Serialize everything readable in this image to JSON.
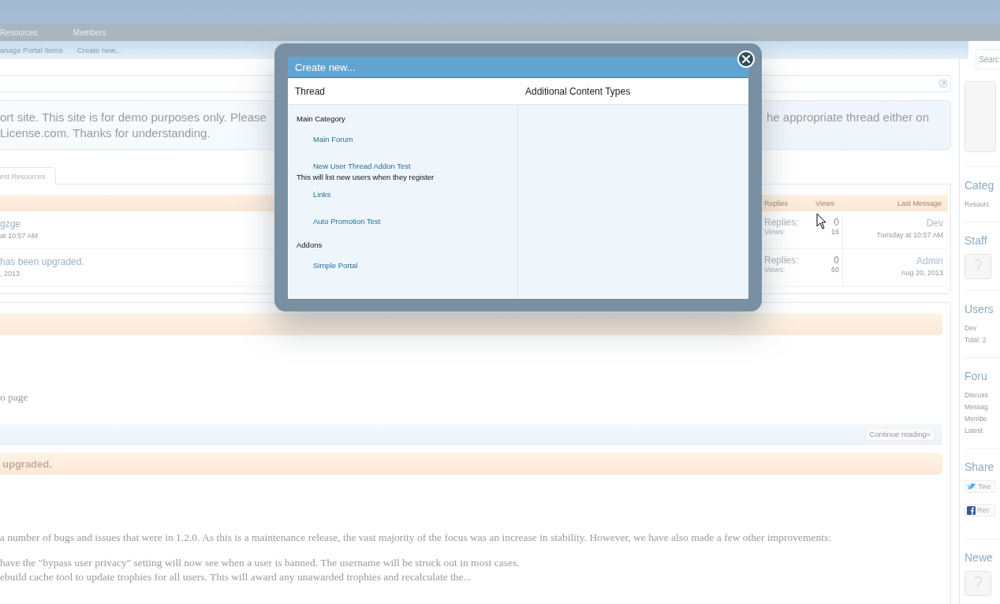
{
  "top_nav": {
    "items": [
      "Resources",
      "Members"
    ]
  },
  "sub_nav": {
    "items": [
      "anage Portal Items",
      "Create new..."
    ]
  },
  "search": {
    "placeholder": "Searc"
  },
  "notice": {
    "left_lines": [
      "ort site. This site is for demo purposes only. Please",
      "License.com. Thanks for understanding."
    ],
    "right_lines": [
      "he appropriate thread either on"
    ]
  },
  "tabs": [
    {
      "label": "est Resources",
      "selected": true
    }
  ],
  "thread_list": {
    "columns": [
      "Replies",
      "Views",
      "Last Message"
    ],
    "rows": [
      {
        "title": "gzge",
        "meta": "at 10:57 AM",
        "replies_label": "Replies:",
        "replies": "0",
        "views_label": "Views:",
        "views": "16",
        "last_user": "Dev",
        "last_date": "Tuesday at 10:57 AM"
      },
      {
        "title": "has been upgraded.",
        "meta": ", 2013",
        "replies_label": "Replies:",
        "replies": "0",
        "views_label": "Views:",
        "views": "60",
        "last_user": "Admin",
        "last_date": "Aug 20, 2013"
      }
    ]
  },
  "posts": [
    {
      "body": [
        "o page"
      ],
      "action": "Continue reading»"
    },
    {
      "title": "upgraded.",
      "body": [
        "a number of bugs and issues that were in 1.2.0. As this is a maintenance release, the vast majority of the focus was an increase in stability. However, we have also made a few other improvements:"
      ],
      "list": [
        "have the \"bypass user privacy\" setting will now see when a user is banned. The username will be struck out in most cases.",
        "ebuild cache tool to update trophies for all users. This will award any unawarded trophies and recalculate the..."
      ]
    }
  ],
  "sidebar": {
    "sections": [
      {
        "kind": "avatar"
      },
      {
        "kind": "list",
        "title": "Categ",
        "lines": [
          "Resourc"
        ]
      },
      {
        "kind": "avatars",
        "title": "Staff"
      },
      {
        "kind": "list",
        "title": "Users",
        "lines": [
          "Dev",
          "Total: 2"
        ]
      },
      {
        "kind": "list",
        "title": "Foru",
        "lines": [
          "Discuss",
          "Messag",
          "Membe",
          "Latest"
        ]
      },
      {
        "kind": "share",
        "title": "Share",
        "buttons": [
          {
            "kind": "twitter",
            "label": "Twe"
          },
          {
            "kind": "facebook",
            "label": "Rec"
          }
        ]
      },
      {
        "kind": "avatars",
        "title": "Newe"
      }
    ]
  },
  "modal": {
    "title": "Create new...",
    "columns": [
      "Thread",
      "Additional Content Types"
    ],
    "groups": [
      {
        "name": "Main Category",
        "items": [
          {
            "label": "Main Forum"
          },
          {
            "label": "New User Thread Addon Test",
            "description": "This will list new users when they register"
          },
          {
            "label": "Links"
          },
          {
            "label": "Auto Promotion Test"
          }
        ]
      },
      {
        "name": "Addons",
        "items": [
          {
            "label": "Simple Portal"
          }
        ]
      }
    ]
  }
}
